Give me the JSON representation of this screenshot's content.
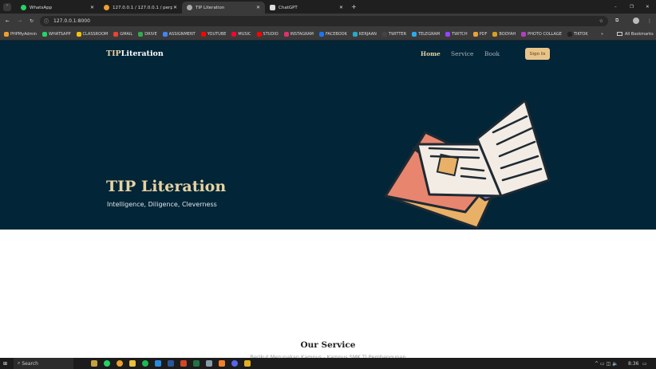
{
  "browser": {
    "tabs": [
      {
        "label": "WhatsApp",
        "icon": "whatsapp-icon",
        "color": "#25d366"
      },
      {
        "label": "127.0.0.1 / 127.0.0.1 / perpus | ...",
        "icon": "phpmyadmin-icon",
        "color": "#f0a030"
      },
      {
        "label": "TIP Literation",
        "icon": "page-icon",
        "color": "#aaaaaa",
        "active": true
      },
      {
        "label": "ChatGPT",
        "icon": "chatgpt-icon",
        "color": "#dddddd"
      }
    ],
    "url": "127.0.0.1:8000",
    "bookmarks": [
      {
        "label": "PHPMyAdmin",
        "color": "#f0a030"
      },
      {
        "label": "WHATSAPP",
        "color": "#25d366"
      },
      {
        "label": "CLASSROOM",
        "color": "#f4c20d"
      },
      {
        "label": "GMAIL",
        "color": "#ea4335"
      },
      {
        "label": "DRIVE",
        "color": "#34a853"
      },
      {
        "label": "ASSIGNMENT",
        "color": "#4285f4"
      },
      {
        "label": "YOUTUBE",
        "color": "#ff0000"
      },
      {
        "label": "MUSIC",
        "color": "#ff0033"
      },
      {
        "label": "STUDIO",
        "color": "#ff0000"
      },
      {
        "label": "INSTAGRAM",
        "color": "#e1306c"
      },
      {
        "label": "FACEBOOK",
        "color": "#1877f2"
      },
      {
        "label": "KERJAAN",
        "color": "#2aa8c8"
      },
      {
        "label": "TWITTER",
        "color": "#444444"
      },
      {
        "label": "TELEGRAM",
        "color": "#2aabee"
      },
      {
        "label": "TWITCH",
        "color": "#9146ff"
      },
      {
        "label": "PDF",
        "color": "#e8a23a"
      },
      {
        "label": "BOOYAH",
        "color": "#d8a020"
      },
      {
        "label": "PHOTO COLLAGE",
        "color": "#b040c0"
      },
      {
        "label": "TIKTOK",
        "color": "#222222"
      }
    ],
    "all_bookmarks": "All Bookmarks"
  },
  "navbar": {
    "logo_a": "TIP",
    "logo_b": "Literation",
    "links": [
      "Home",
      "Service",
      "Book"
    ],
    "signin": "Sign In"
  },
  "hero": {
    "title": "TIP Literation",
    "subtitle": "Intelligence, Diligence, Cleverness"
  },
  "service": {
    "title": "Our Service",
    "subtitle": "Berikut Merupakan Kampus - Kampus SMK TI Pembangunan"
  },
  "taskbar": {
    "search": "Search",
    "time": "8:36"
  },
  "colors": {
    "hero_bg": "#022537",
    "accent": "#e6d3a3",
    "button": "#e8c48b"
  }
}
